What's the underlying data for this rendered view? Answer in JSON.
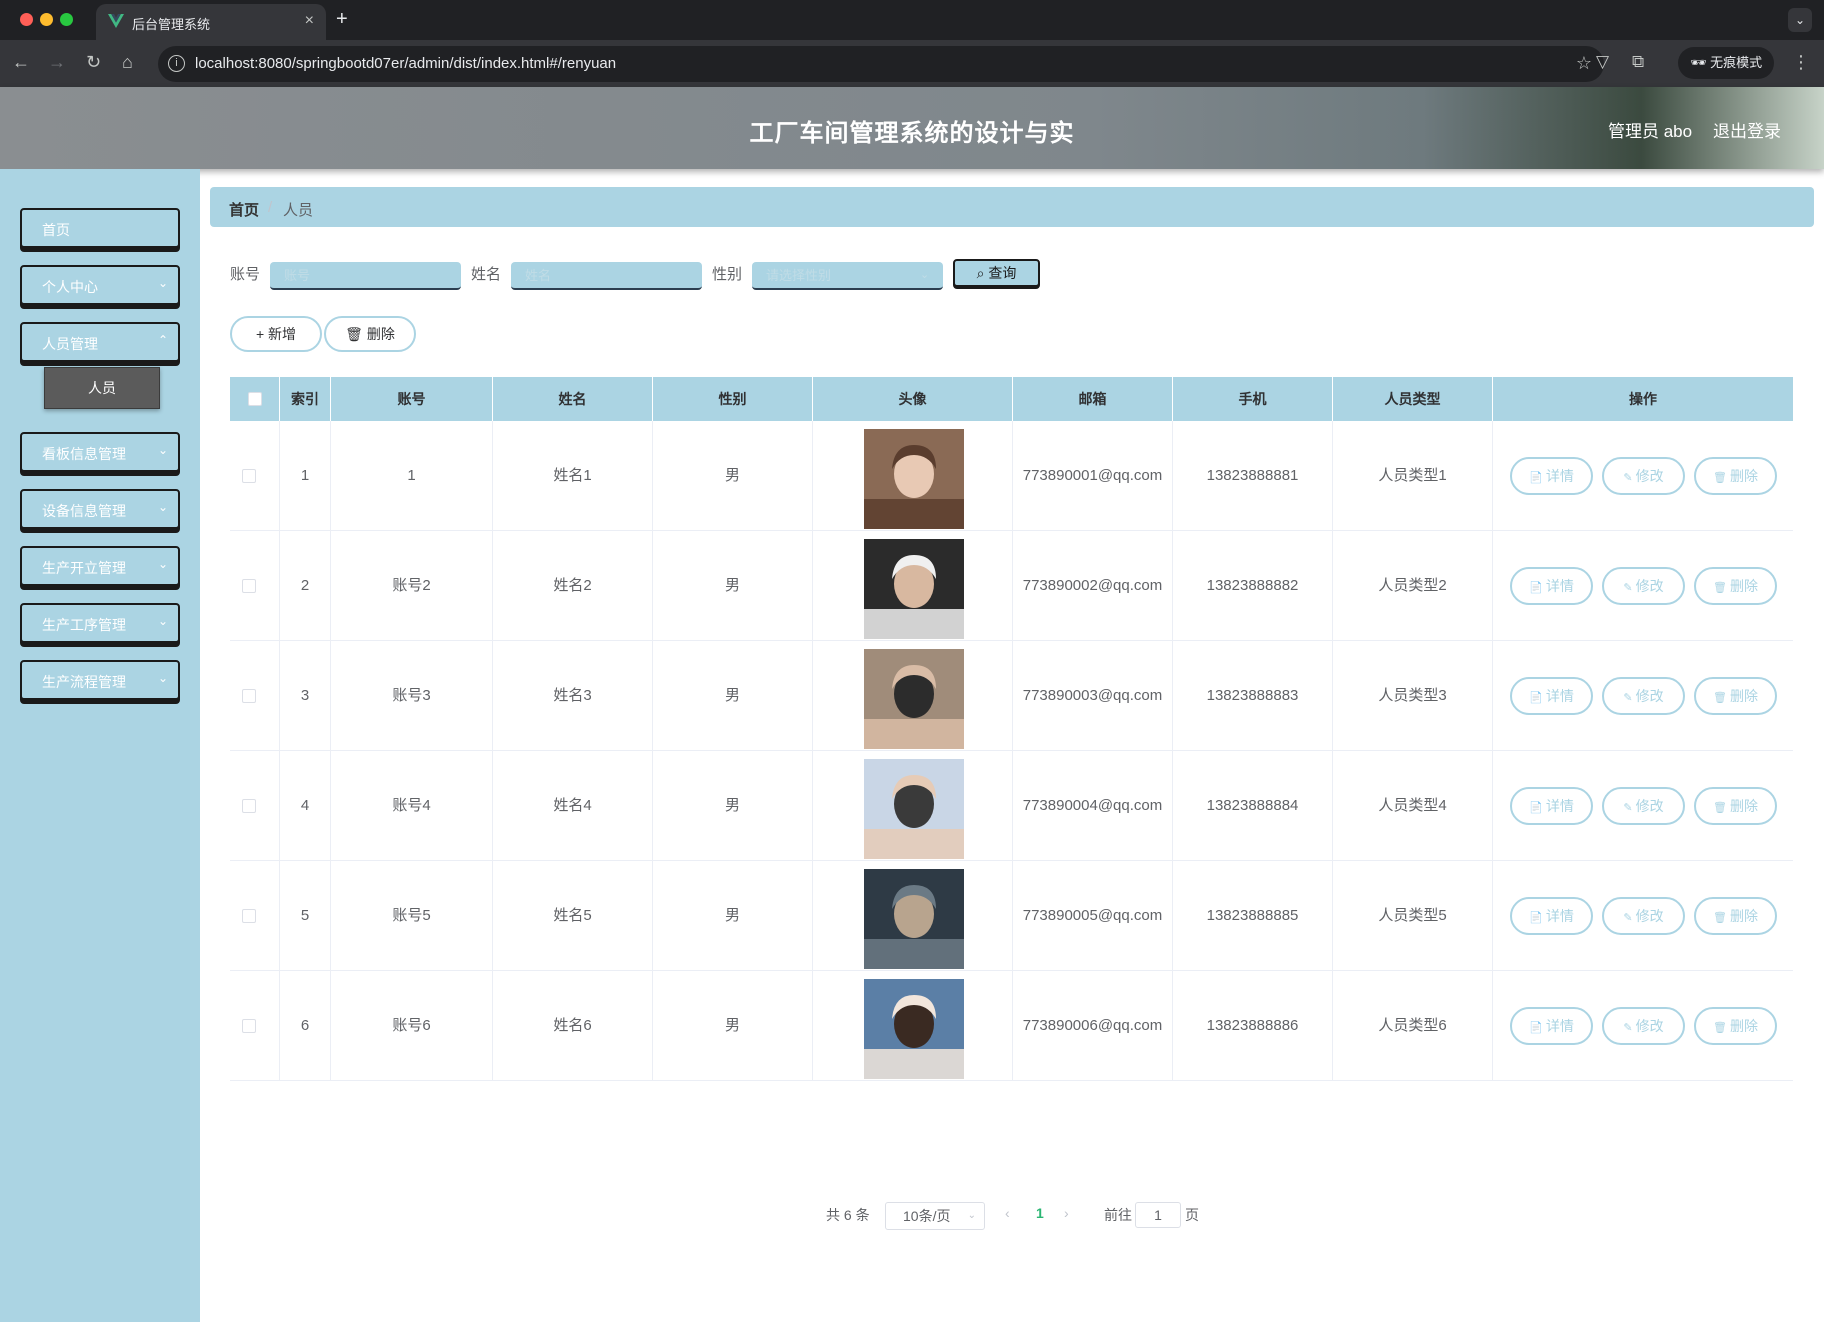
{
  "browser": {
    "tab_title": "后台管理系统",
    "url": "localhost:8080/springbootd07er/admin/dist/index.html#/renyuan",
    "incognito_label": "无痕模式"
  },
  "header": {
    "title": "工厂车间管理系统的设计与实",
    "user_label": "管理员 abo",
    "logout_label": "退出登录"
  },
  "sidebar": {
    "items": [
      {
        "label": "首页",
        "has_arrow": false
      },
      {
        "label": "个人中心",
        "has_arrow": true
      },
      {
        "label": "人员管理",
        "has_arrow": true
      },
      {
        "label": "看板信息管理",
        "has_arrow": true
      },
      {
        "label": "设备信息管理",
        "has_arrow": true
      },
      {
        "label": "生产开立管理",
        "has_arrow": true
      },
      {
        "label": "生产工序管理",
        "has_arrow": true
      },
      {
        "label": "生产流程管理",
        "has_arrow": true
      }
    ],
    "active_sub_item": "人员"
  },
  "breadcrumb": {
    "home": "首页",
    "separator": "/",
    "current": "人员"
  },
  "search": {
    "account_label": "账号",
    "account_placeholder": "账号",
    "name_label": "姓名",
    "name_placeholder": "姓名",
    "gender_label": "性别",
    "gender_placeholder": "请选择性别",
    "query_label": "查询"
  },
  "actions": {
    "add_label": "新增",
    "delete_label": "删除"
  },
  "table": {
    "columns": [
      "索引",
      "账号",
      "姓名",
      "性别",
      "头像",
      "邮箱",
      "手机",
      "人员类型",
      "操作"
    ],
    "op_labels": {
      "detail": "详情",
      "edit": "修改",
      "delete": "删除"
    },
    "rows": [
      {
        "index": "1",
        "account": "1",
        "name": "姓名1",
        "gender": "男",
        "email": "773890001@qq.com",
        "phone": "13823888881",
        "type": "人员类型1"
      },
      {
        "index": "2",
        "account": "账号2",
        "name": "姓名2",
        "gender": "男",
        "email": "773890002@qq.com",
        "phone": "13823888882",
        "type": "人员类型2"
      },
      {
        "index": "3",
        "account": "账号3",
        "name": "姓名3",
        "gender": "男",
        "email": "773890003@qq.com",
        "phone": "13823888883",
        "type": "人员类型3"
      },
      {
        "index": "4",
        "account": "账号4",
        "name": "姓名4",
        "gender": "男",
        "email": "773890004@qq.com",
        "phone": "13823888884",
        "type": "人员类型4"
      },
      {
        "index": "5",
        "account": "账号5",
        "name": "姓名5",
        "gender": "男",
        "email": "773890005@qq.com",
        "phone": "13823888885",
        "type": "人员类型5"
      },
      {
        "index": "6",
        "account": "账号6",
        "name": "姓名6",
        "gender": "男",
        "email": "773890006@qq.com",
        "phone": "13823888886",
        "type": "人员类型6"
      }
    ]
  },
  "pagination": {
    "total": "共 6 条",
    "page_size": "10条/页",
    "current_page": "1",
    "goto_label": "前往",
    "goto_value": "1",
    "page_unit": "页"
  },
  "colors": {
    "accent": "#abd4e3",
    "active_page": "#2bb673",
    "sidebar_active": "#5b5b5b"
  }
}
